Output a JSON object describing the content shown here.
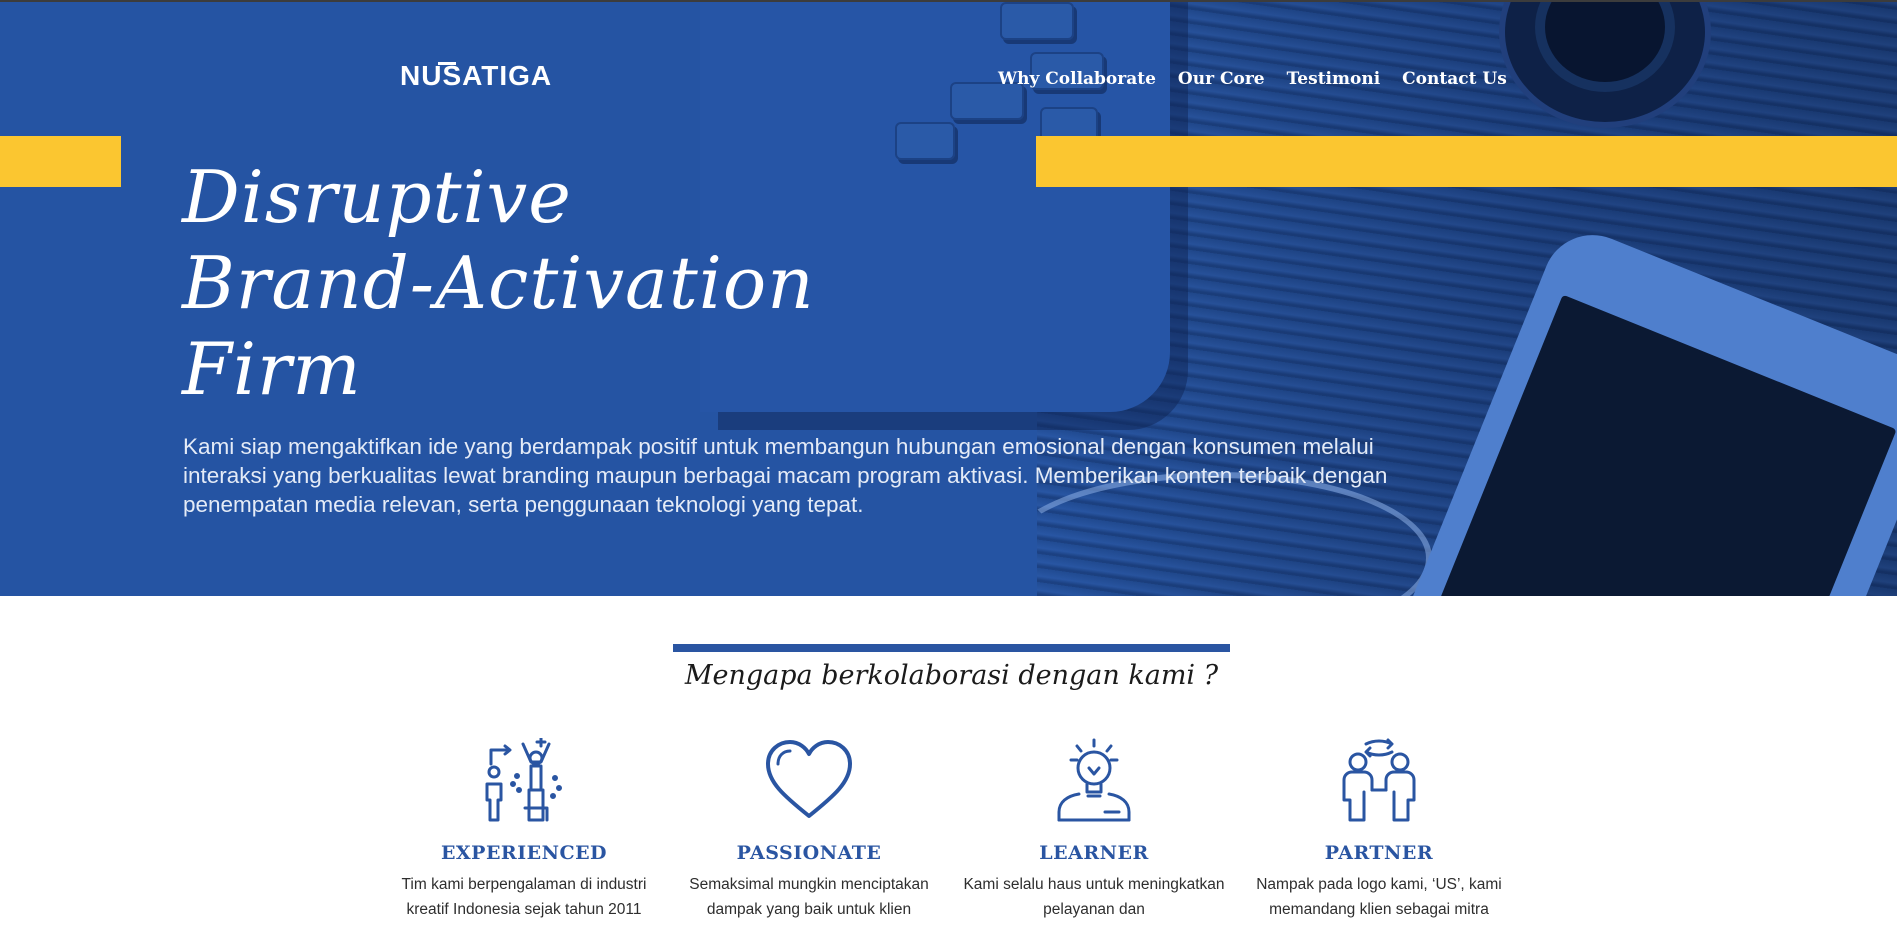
{
  "brand": {
    "logo_text": "NUSATIGA"
  },
  "nav": {
    "items": [
      {
        "label": "Why Collaborate"
      },
      {
        "label": "Our Core"
      },
      {
        "label": "Testimoni"
      },
      {
        "label": "Contact Us"
      }
    ]
  },
  "hero": {
    "title_lines": [
      "Disruptive",
      "Brand-Activation",
      "Firm"
    ],
    "description": "Kami siap mengaktifkan ide yang berdampak positif untuk membangun hubungan emosional dengan konsumen melalui interaksi yang berkualitas lewat branding maupun berbagai macam program aktivasi. Memberikan konten terbaik dengan penempatan media relevan, serta penggunaan teknologi yang tepat."
  },
  "why_section": {
    "title": "Mengapa berkolaborasi dengan kami ?",
    "features": [
      {
        "icon": "success-person-icon",
        "title": "EXPERIENCED",
        "description": "Tim kami berpengalaman di industri kreatif Indonesia sejak tahun 2011"
      },
      {
        "icon": "heart-icon",
        "title": "PASSIONATE",
        "description": "Semaksimal mungkin menciptakan dampak yang baik untuk klien"
      },
      {
        "icon": "lightbulb-head-icon",
        "title": "LEARNER",
        "description": "Kami selalu haus untuk meningkatkan pelayanan dan"
      },
      {
        "icon": "partners-handshake-icon",
        "title": "PARTNER",
        "description": "Nampak pada logo kami, ‘US’, kami memandang klien sebagai mitra"
      }
    ]
  },
  "colors": {
    "hero_blue": "#2554a3",
    "accent_yellow": "#fbc630",
    "accent_blue": "#2a55a2",
    "text_dark": "#2e2e2e"
  }
}
